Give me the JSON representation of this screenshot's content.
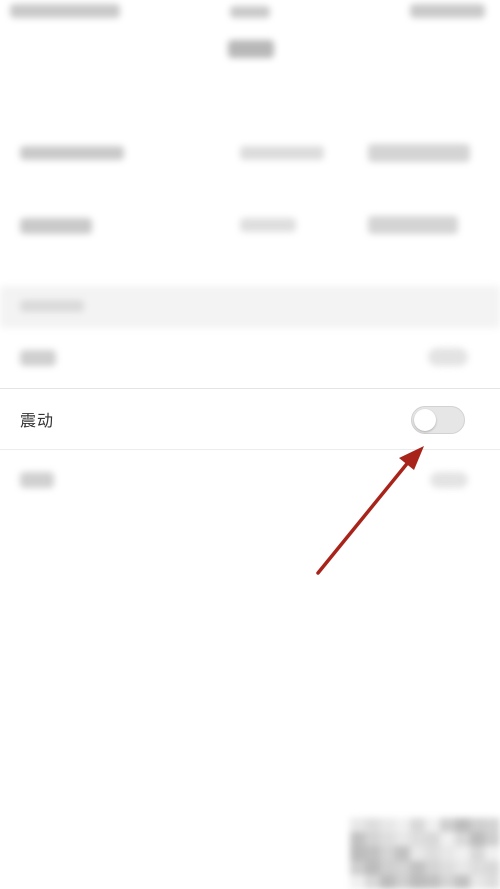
{
  "settings": {
    "vibration_label": "震动",
    "vibration_enabled": false
  },
  "colors": {
    "annotation_arrow": "#a8231a",
    "toggle_off_track": "#e6e6e6"
  },
  "icons": {
    "annotation": "red-arrow-icon"
  }
}
